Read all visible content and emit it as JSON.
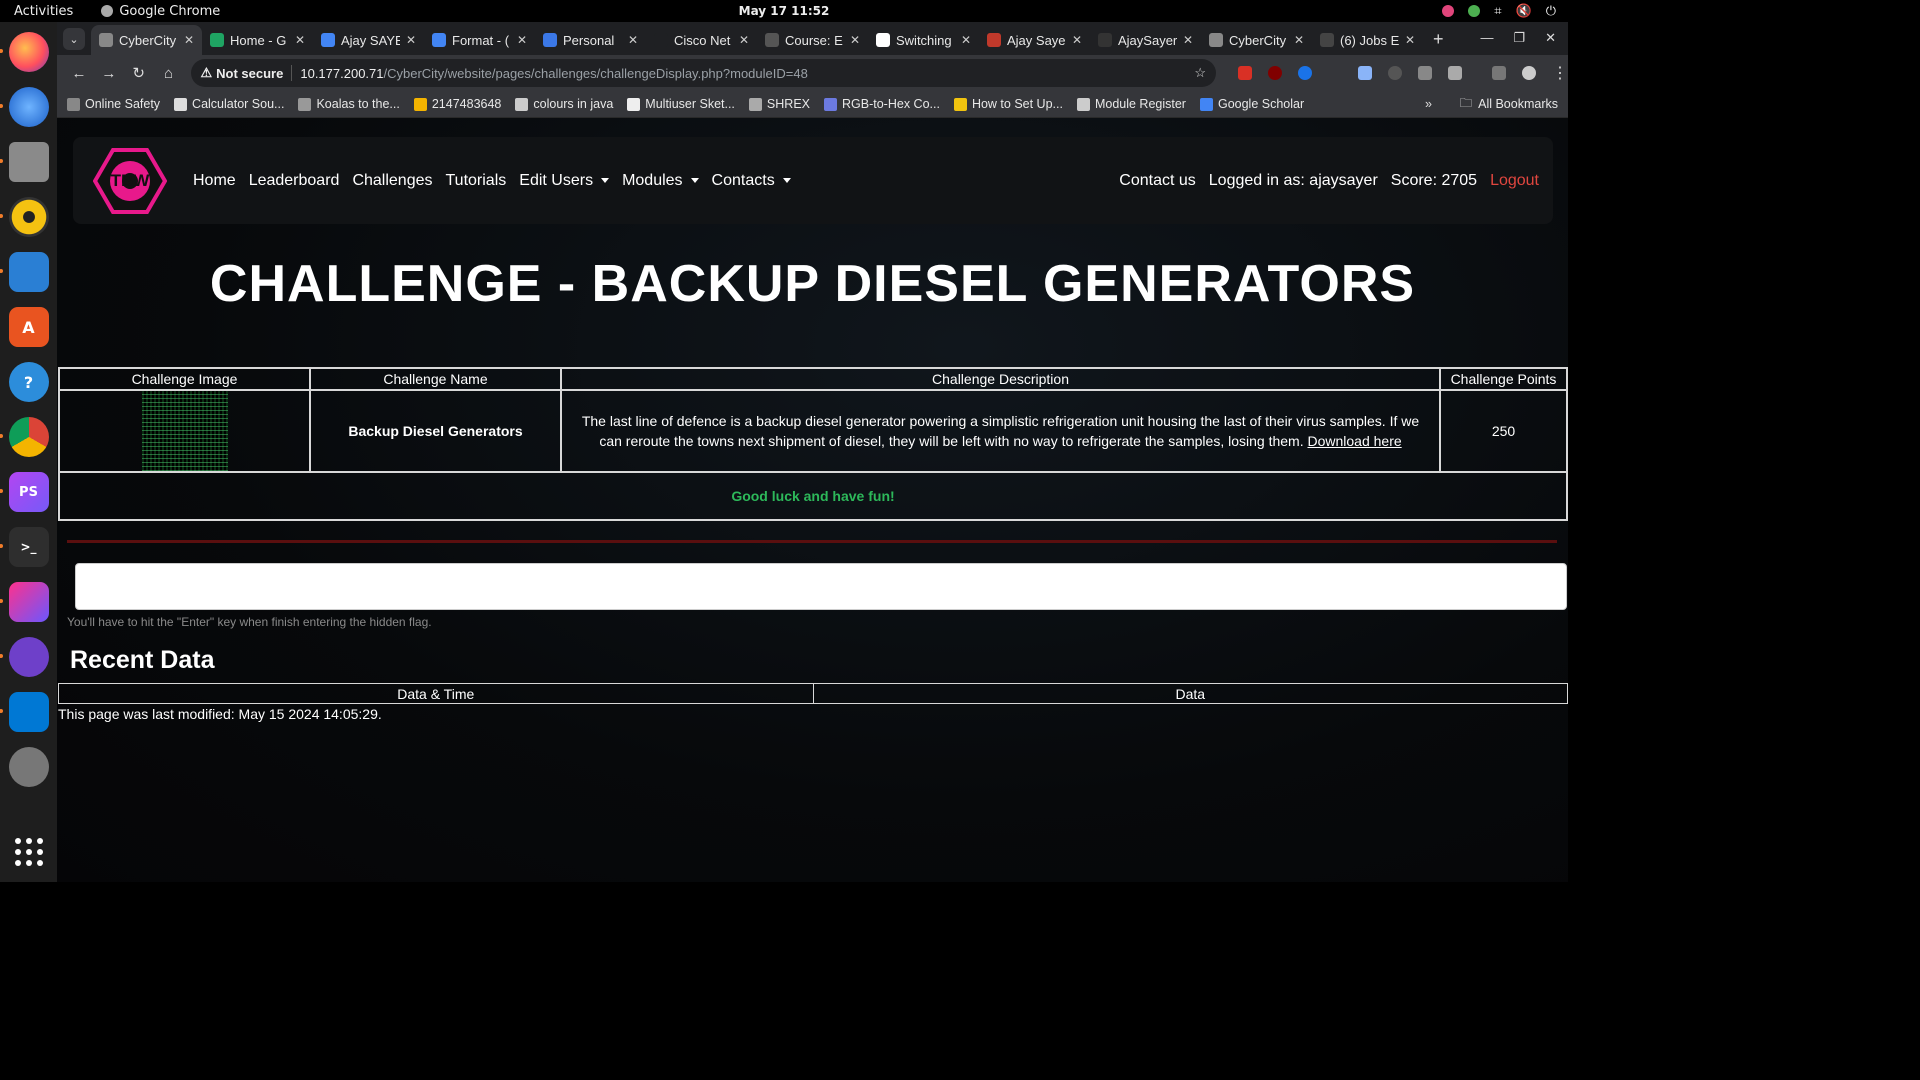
{
  "system_bar": {
    "activities": "Activities",
    "app_name": "Google Chrome",
    "clock": "May 17  11:52"
  },
  "dock": {
    "items": [
      "firefox-icon",
      "thunderbird-icon",
      "files-icon",
      "rhythmbox-icon",
      "writer-icon",
      "app-center-icon",
      "help-icon",
      "chrome-icon",
      "phpstorm-icon",
      "terminal-icon",
      "jetbrains-toolbox-icon",
      "github-desktop-icon",
      "vscode-icon",
      "disk-utility-icon"
    ],
    "show_apps": "show-applications-icon"
  },
  "tabs": [
    {
      "label": "CyberCity",
      "active": true,
      "color": "#888888"
    },
    {
      "label": "Home - G",
      "color": "#1fa463"
    },
    {
      "label": "Ajay SAYE",
      "color": "#4285f4"
    },
    {
      "label": "Format - (",
      "color": "#4285f4"
    },
    {
      "label": "Personal",
      "color": "#3b78e7"
    },
    {
      "label": "Cisco Net",
      "color": "#1f2023"
    },
    {
      "label": "Course: E",
      "color": "#555555"
    },
    {
      "label": "Switching",
      "color": "#ffffff"
    },
    {
      "label": "Ajay Saye",
      "color": "#c0392b"
    },
    {
      "label": "AjaySayer",
      "color": "#333333"
    },
    {
      "label": "CyberCity",
      "color": "#888888"
    },
    {
      "label": "(6) Jobs E",
      "color": "#444444"
    }
  ],
  "address_bar": {
    "security": "Not secure",
    "host": "10.177.200.71",
    "path": "/CyberCity/website/pages/challenges/challengeDisplay.php?moduleID=48"
  },
  "bookmarks": [
    {
      "label": "Online Safety",
      "color": "#888888"
    },
    {
      "label": "Calculator Sou...",
      "color": "#dddddd"
    },
    {
      "label": "Koalas to the...",
      "color": "#999999"
    },
    {
      "label": "2147483648",
      "color": "#f4b400"
    },
    {
      "label": "colours in java",
      "color": "#cccccc"
    },
    {
      "label": "Multiuser Sket...",
      "color": "#eeeeee"
    },
    {
      "label": "SHREX",
      "color": "#aaaaaa"
    },
    {
      "label": "RGB-to-Hex Co...",
      "color": "#6c7ae0"
    },
    {
      "label": "How to Set Up...",
      "color": "#f1c40f"
    },
    {
      "label": "Module Register",
      "color": "#cccccc"
    },
    {
      "label": "Google Scholar",
      "color": "#4285f4"
    }
  ],
  "bookmarks_all": "All Bookmarks",
  "navbar": {
    "logo_text": "TBW",
    "links": [
      "Home",
      "Leaderboard",
      "Challenges",
      "Tutorials"
    ],
    "dropdowns": [
      "Edit Users",
      "Modules",
      "Contacts"
    ],
    "contact": "Contact us",
    "logged_in": "Logged in as: ajaysayer",
    "score": "Score: 2705",
    "logout": "Logout"
  },
  "page_title": "CHALLENGE - BACKUP DIESEL GENERATORS",
  "challenge_table": {
    "headers": [
      "Challenge Image",
      "Challenge Name",
      "Challenge Description",
      "Challenge Points"
    ],
    "name": "Backup Diesel Generators",
    "description": "The last line of defence is a backup diesel generator powering a simplistic refrigeration unit housing the last of their virus samples. If we can reroute the towns next shipment of diesel, they will be left with no way to refrigerate the samples, losing them.",
    "download_link": "Download here",
    "points": "250",
    "footer": "Good luck and have fun!"
  },
  "flag_input": {
    "value": "",
    "placeholder": ""
  },
  "hint": "You'll have to hit the \"Enter\" key when finish entering the hidden flag.",
  "recent": {
    "heading": "Recent Data",
    "headers": [
      "Data & Time",
      "Data"
    ]
  },
  "last_modified": "This page was last modified: May 15 2024 14:05:29."
}
